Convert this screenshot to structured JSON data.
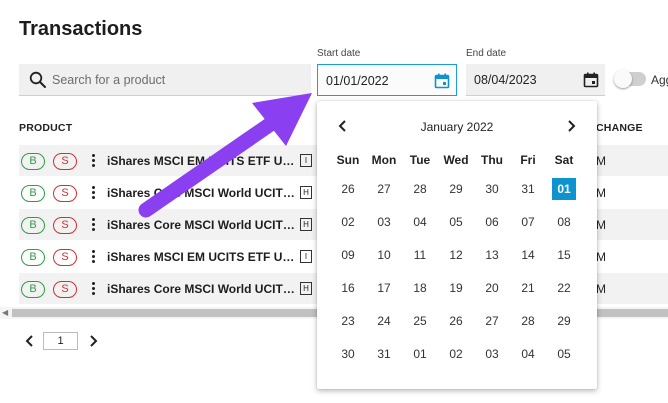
{
  "page": {
    "title": "Transactions"
  },
  "search": {
    "placeholder": "Search for a product",
    "icon": "search-icon"
  },
  "start_date": {
    "label": "Start date",
    "value": "01/01/2022",
    "icon": "calendar-icon"
  },
  "end_date": {
    "label": "End date",
    "value": "08/04/2023",
    "icon": "calendar-icon"
  },
  "toggle": {
    "label": "Agg",
    "on": false
  },
  "table": {
    "columns": {
      "product": "PRODUCT",
      "change": "CHANGE"
    },
    "rows": [
      {
        "buy": "B",
        "sell": "S",
        "name": "iShares MSCI EM UCITS ETF USD...",
        "type": "I",
        "change": "M"
      },
      {
        "buy": "B",
        "sell": "S",
        "name": "iShares Core MSCI World UCITS ...",
        "type": "H",
        "change": "M"
      },
      {
        "buy": "B",
        "sell": "S",
        "name": "iShares Core MSCI World UCITS ...",
        "type": "H",
        "change": "M"
      },
      {
        "buy": "B",
        "sell": "S",
        "name": "iShares MSCI EM UCITS ETF USD...",
        "type": "I",
        "change": "M"
      },
      {
        "buy": "B",
        "sell": "S",
        "name": "iShares Core MSCI World UCITS ...",
        "type": "H",
        "change": "M"
      }
    ]
  },
  "pager": {
    "page": "1"
  },
  "calendar": {
    "month": "January 2022",
    "weekdays": [
      "Sun",
      "Mon",
      "Tue",
      "Wed",
      "Thu",
      "Fri",
      "Sat"
    ],
    "weeks": [
      [
        "26",
        "27",
        "28",
        "29",
        "30",
        "31",
        "01"
      ],
      [
        "02",
        "03",
        "04",
        "05",
        "06",
        "07",
        "08"
      ],
      [
        "09",
        "10",
        "11",
        "12",
        "13",
        "14",
        "15"
      ],
      [
        "16",
        "17",
        "18",
        "19",
        "20",
        "21",
        "22"
      ],
      [
        "23",
        "24",
        "25",
        "26",
        "27",
        "28",
        "29"
      ],
      [
        "30",
        "31",
        "01",
        "02",
        "03",
        "04",
        "05"
      ]
    ],
    "selected": "01",
    "accent": "#0d93d0"
  },
  "annotation": {
    "arrow_color": "#8a3ff0"
  }
}
